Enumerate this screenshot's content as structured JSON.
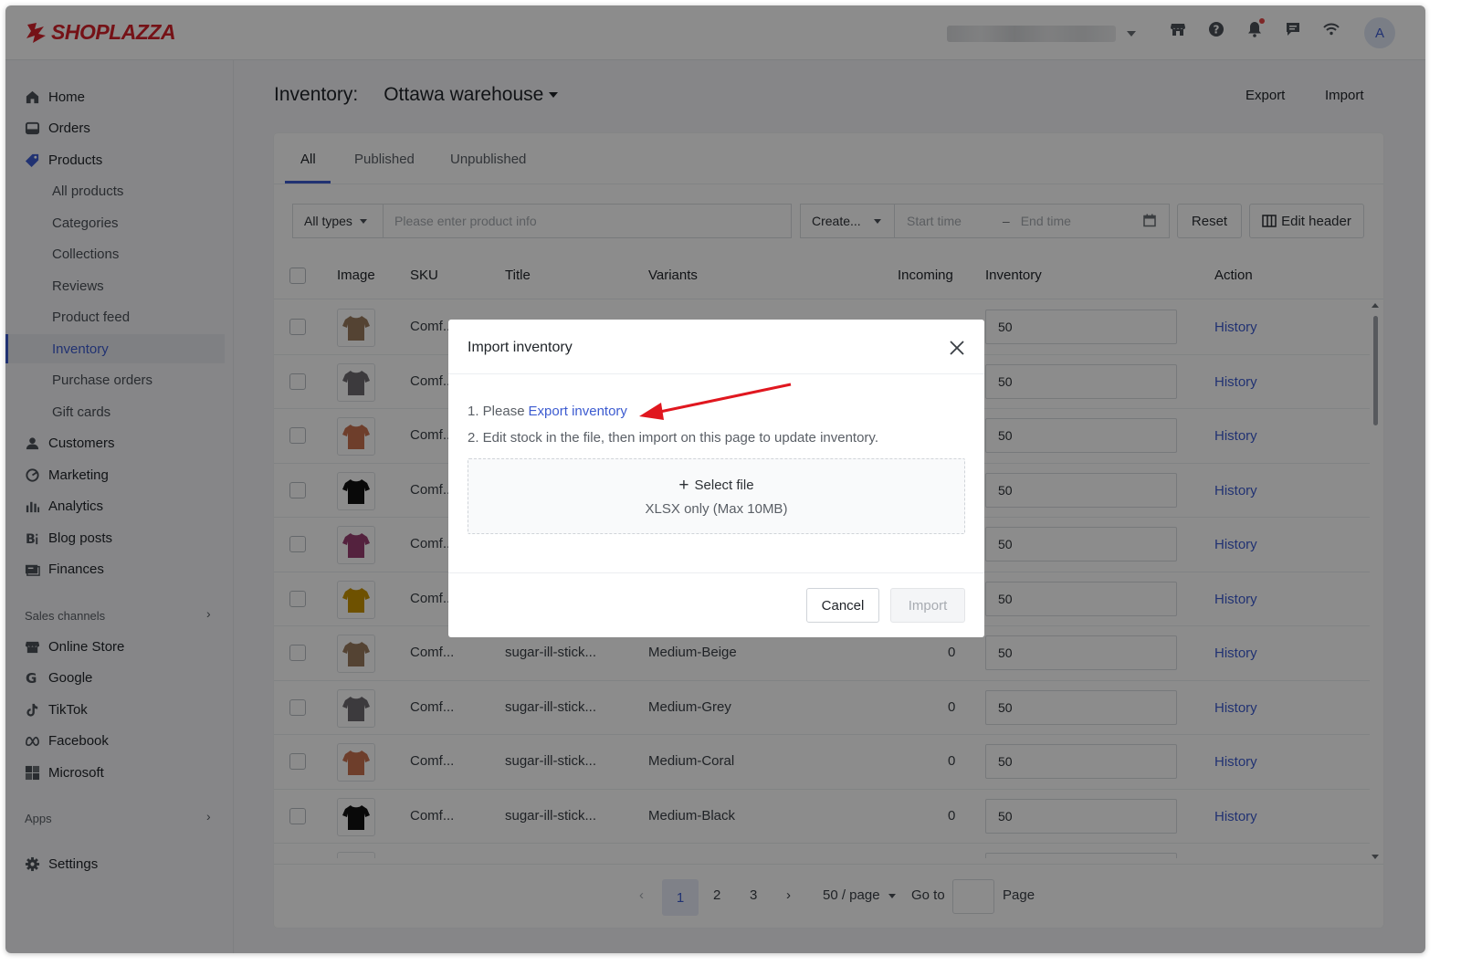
{
  "brand": {
    "name": "SHOPLAZZA",
    "color": "#d6222a"
  },
  "topbar": {
    "icons": [
      "store-icon",
      "help-icon",
      "bell-icon",
      "chat-icon",
      "wifi-icon"
    ],
    "avatar_letter": "A"
  },
  "sidebar": {
    "items": [
      {
        "label": "Home",
        "icon": "home-icon"
      },
      {
        "label": "Orders",
        "icon": "orders-icon"
      },
      {
        "label": "Products",
        "icon": "tag-icon"
      }
    ],
    "product_sub": [
      "All products",
      "Categories",
      "Collections",
      "Reviews",
      "Product feed",
      "Inventory",
      "Purchase orders",
      "Gift cards"
    ],
    "items2": [
      {
        "label": "Customers",
        "icon": "person-icon"
      },
      {
        "label": "Marketing",
        "icon": "marketing-icon"
      },
      {
        "label": "Analytics",
        "icon": "analytics-icon"
      },
      {
        "label": "Blog posts",
        "icon": "blog-icon"
      },
      {
        "label": "Finances",
        "icon": "finance-icon"
      }
    ],
    "sales_channels_label": "Sales channels",
    "channels": [
      {
        "label": "Online Store",
        "icon": "store-icon"
      },
      {
        "label": "Google",
        "icon": "google-icon"
      },
      {
        "label": "TikTok",
        "icon": "tiktok-icon"
      },
      {
        "label": "Facebook",
        "icon": "meta-icon"
      },
      {
        "label": "Microsoft",
        "icon": "microsoft-icon"
      }
    ],
    "apps_label": "Apps",
    "settings_label": "Settings"
  },
  "page": {
    "title": "Inventory:",
    "warehouse": "Ottawa warehouse",
    "export_label": "Export",
    "import_label": "Import"
  },
  "tabs": [
    "All",
    "Published",
    "Unpublished"
  ],
  "filters": {
    "type_select": "All types",
    "search_placeholder": "Please enter product info",
    "create_select": "Create...",
    "start_placeholder": "Start time",
    "end_placeholder": "End time",
    "reset_label": "Reset",
    "edit_header_label": "Edit header"
  },
  "table": {
    "headers": [
      "Image",
      "SKU",
      "Title",
      "Variants",
      "Incoming",
      "Inventory",
      "Action"
    ],
    "rows": [
      {
        "sku": "Comf...",
        "title": "",
        "variant": "",
        "incoming": "",
        "inventory": "50",
        "action": "History",
        "color": "#9a7a5e"
      },
      {
        "sku": "Comf...",
        "title": "",
        "variant": "",
        "incoming": "",
        "inventory": "50",
        "action": "History",
        "color": "#6e6a70"
      },
      {
        "sku": "Comf...",
        "title": "",
        "variant": "",
        "incoming": "",
        "inventory": "50",
        "action": "History",
        "color": "#c9714f"
      },
      {
        "sku": "Comf...",
        "title": "",
        "variant": "",
        "incoming": "",
        "inventory": "50",
        "action": "History",
        "color": "#111111"
      },
      {
        "sku": "Comf...",
        "title": "",
        "variant": "",
        "incoming": "",
        "inventory": "50",
        "action": "History",
        "color": "#9a3f71"
      },
      {
        "sku": "Comf...",
        "title": "",
        "variant": "",
        "incoming": "",
        "inventory": "50",
        "action": "History",
        "color": "#c99400"
      },
      {
        "sku": "Comf...",
        "title": "sugar-ill-stick...",
        "variant": "Medium-Beige",
        "incoming": "0",
        "inventory": "50",
        "action": "History",
        "color": "#9a7a5e"
      },
      {
        "sku": "Comf...",
        "title": "sugar-ill-stick...",
        "variant": "Medium-Grey",
        "incoming": "0",
        "inventory": "50",
        "action": "History",
        "color": "#6e6a70"
      },
      {
        "sku": "Comf...",
        "title": "sugar-ill-stick...",
        "variant": "Medium-Coral",
        "incoming": "0",
        "inventory": "50",
        "action": "History",
        "color": "#c9714f"
      },
      {
        "sku": "Comf...",
        "title": "sugar-ill-stick...",
        "variant": "Medium-Black",
        "incoming": "0",
        "inventory": "50",
        "action": "History",
        "color": "#111111"
      }
    ]
  },
  "pagination": {
    "pages": [
      "1",
      "2",
      "3"
    ],
    "current": "1",
    "per_page": "50 / page",
    "goto_label": "Go to",
    "page_label": "Page"
  },
  "modal": {
    "title": "Import inventory",
    "step1_prefix": "1. Please",
    "step1_link": "Export inventory",
    "step2": "2. Edit stock in the file, then import on this page to update inventory.",
    "select_file": "Select file",
    "file_hint": "XLSX only (Max 10MB)",
    "cancel_label": "Cancel",
    "import_label": "Import"
  },
  "accent_color": "#3c5bd0",
  "annotation_arrow_color": "#e0171f"
}
